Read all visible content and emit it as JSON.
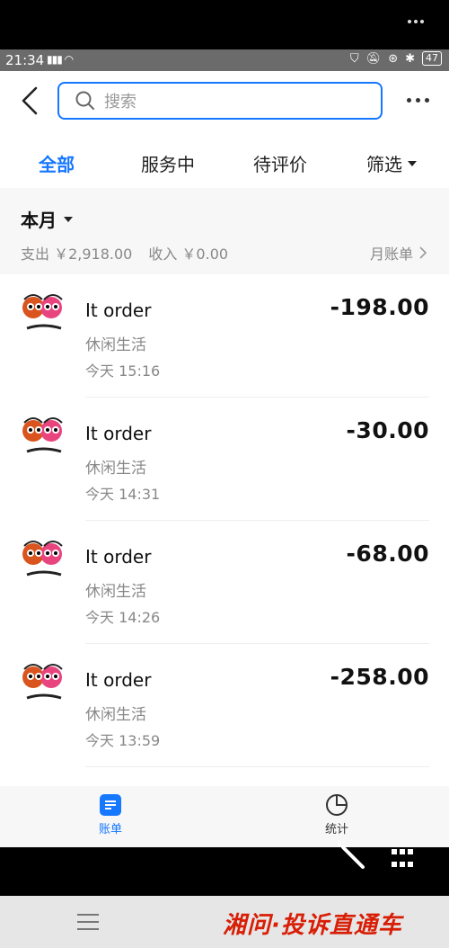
{
  "status_bar": {
    "time": "21:34",
    "battery": "47"
  },
  "search": {
    "placeholder": "搜索"
  },
  "tabs": [
    {
      "label": "全部",
      "active": true
    },
    {
      "label": "服务中",
      "active": false
    },
    {
      "label": "待评价",
      "active": false
    },
    {
      "label": "筛选",
      "active": false
    }
  ],
  "summary": {
    "month": "本月",
    "expense": "支出 ￥2,918.00",
    "income": "收入 ￥0.00",
    "monthly_bill": "月账单"
  },
  "transactions": [
    {
      "title": "It order",
      "category": "休闲生活",
      "time": "今天  15:16",
      "amount": "-198.00"
    },
    {
      "title": "It order",
      "category": "休闲生活",
      "time": "今天  14:31",
      "amount": "-30.00"
    },
    {
      "title": "It order",
      "category": "休闲生活",
      "time": "今天  14:26",
      "amount": "-68.00"
    },
    {
      "title": "It order",
      "category": "休闲生活",
      "time": "今天  13:59",
      "amount": "-258.00"
    }
  ],
  "bottom_nav": [
    {
      "label": "账单",
      "active": true,
      "icon": "bill-icon"
    },
    {
      "label": "统计",
      "active": false,
      "icon": "pie-chart-icon"
    }
  ],
  "watermark": "湘问·投诉直通车",
  "colors": {
    "accent": "#1677ff",
    "watermark": "#d81e06"
  }
}
